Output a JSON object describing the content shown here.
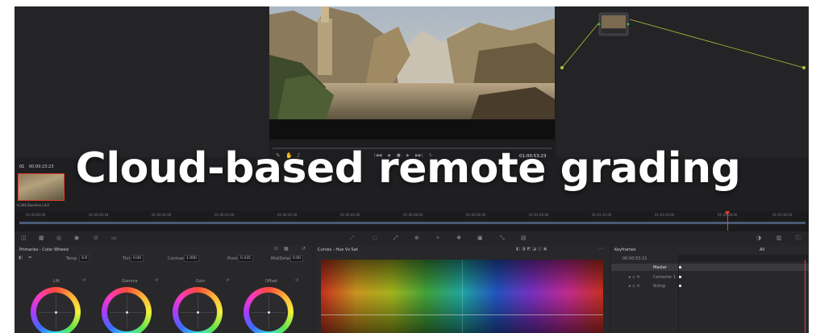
{
  "headline": "Cloud-based remote grading",
  "viewer": {
    "timecode": "01:00:53:23",
    "transport": [
      "|◀◀",
      "◀",
      "■",
      "▶",
      "▶▶|",
      "↻"
    ]
  },
  "clip": {
    "timecode": "00:00:23:23",
    "number": "01",
    "codec": "H.264 Baseline L4.0"
  },
  "timeline": {
    "ticks": [
      "01:00:00:00",
      "01:00:08:18",
      "01:00:16:06",
      "01:00:24:00",
      "01:00:32:00",
      "01:00:40:00",
      "01:00:48:00",
      "01:00:56:00",
      "01:01:04:00",
      "01:01:12:00",
      "01:01:20:00",
      "01:01:28:00",
      "01:01:36:00"
    ]
  },
  "color_wheels": {
    "title": "Primaries - Color Wheels",
    "temp_label": "Temp",
    "temp_value": "0.0",
    "tint_label": "Tint",
    "tint_value": "0.00",
    "contrast_label": "Contrast",
    "contrast_value": "1.000",
    "pivot_label": "Pivot",
    "pivot_value": "0.435",
    "middetail_label": "Mid/Detail",
    "middetail_value": "0.00",
    "wheels": [
      {
        "name": "Lift"
      },
      {
        "name": "Gamma"
      },
      {
        "name": "Gain"
      },
      {
        "name": "Offset"
      }
    ]
  },
  "curves": {
    "title": "Curves - Hue Vs Sat"
  },
  "keyframes": {
    "title": "Keyframes",
    "filter": "All",
    "timecode": "00:00:53:21",
    "tracks": [
      "Master",
      "Corrector 1",
      "Sizing"
    ]
  },
  "colors": {
    "frame_bg": "#232325",
    "playhead": "#e8402e",
    "headline": "#ffffff"
  }
}
